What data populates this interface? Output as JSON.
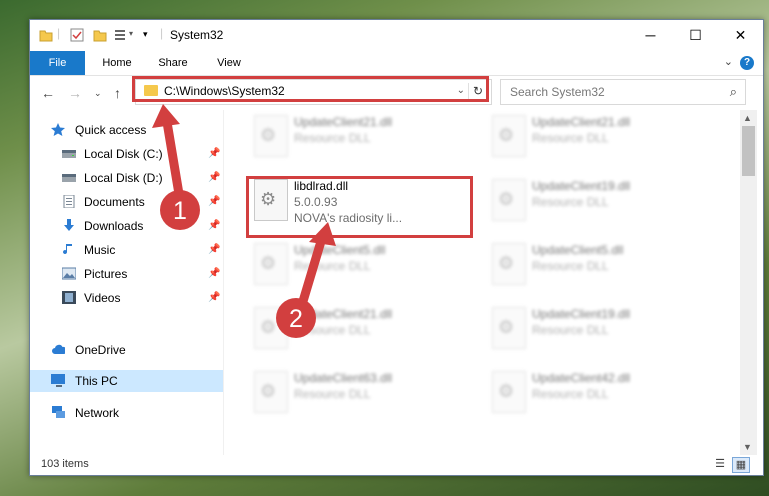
{
  "window": {
    "title": "System32",
    "controls": {
      "minimize": "─",
      "maximize": "☐",
      "close": "✕"
    }
  },
  "ribbon": {
    "tabs": [
      "File",
      "Home",
      "Share",
      "View"
    ],
    "help": "?"
  },
  "address": {
    "path": "C:\\Windows\\System32",
    "search_placeholder": "Search System32"
  },
  "navpane": {
    "quick_access": "Quick access",
    "pinned": [
      {
        "label": "Local Disk (C:)",
        "icon": "drive-icon"
      },
      {
        "label": "Local Disk (D:)",
        "icon": "drive-icon"
      },
      {
        "label": "Documents",
        "icon": "documents-icon"
      },
      {
        "label": "Downloads",
        "icon": "downloads-icon"
      },
      {
        "label": "Music",
        "icon": "music-icon"
      },
      {
        "label": "Pictures",
        "icon": "pictures-icon"
      },
      {
        "label": "Videos",
        "icon": "videos-icon"
      }
    ],
    "onedrive": "OneDrive",
    "this_pc": "This PC",
    "network": "Network"
  },
  "files": {
    "left": [
      {
        "name": "UpdateClient21.dll",
        "desc": "Resource DLL"
      },
      {
        "name": "libdlrad.dll",
        "version": "5.0.0.93",
        "desc": "NOVA's radiosity li..."
      },
      {
        "name": "UpdateClient5.dll",
        "desc": "Resource DLL"
      },
      {
        "name": "UpdateClient21.dll",
        "desc": "Resource DLL"
      },
      {
        "name": "UpdateClient63.dll",
        "desc": "Resource DLL"
      }
    ],
    "right": [
      {
        "name": "UpdateClient21.dll",
        "desc": "Resource DLL"
      },
      {
        "name": "UpdateClient19.dll",
        "desc": "Resource DLL"
      },
      {
        "name": "UpdateClient5.dll",
        "desc": "Resource DLL"
      },
      {
        "name": "UpdateClient19.dll",
        "desc": "Resource DLL"
      },
      {
        "name": "UpdateClient42.dll",
        "desc": "Resource DLL"
      }
    ]
  },
  "status": {
    "item_count": "103 items"
  },
  "annotations": {
    "step1": "1",
    "step2": "2",
    "color": "#d23f3f"
  }
}
